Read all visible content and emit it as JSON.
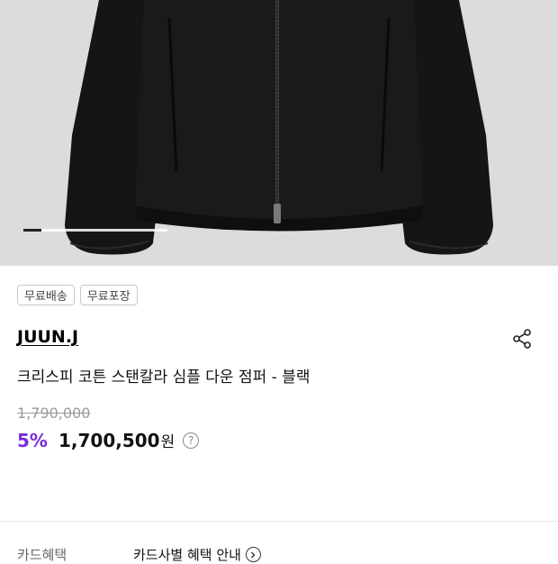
{
  "product_image": {
    "alt_icon": "black-down-jacket-photo",
    "carousel": {
      "current": 1
    }
  },
  "tags": [
    "무료배송",
    "무료포장"
  ],
  "brand": "JUUN.J",
  "product_title": "크리스피 코튼 스탠칼라 심플 다운 점퍼 - 블랙",
  "pricing": {
    "original_price": "1,790,000",
    "discount_rate": "5%",
    "sale_price": "1,700,500",
    "currency_unit": "원",
    "help_icon": "?"
  },
  "card_benefit": {
    "label": "카드혜택",
    "link_label": "카드사별 혜택 안내"
  },
  "colors": {
    "discount": "#7a2bdc",
    "hero_bg": "#dcdcdc",
    "jacket": "#141414"
  }
}
